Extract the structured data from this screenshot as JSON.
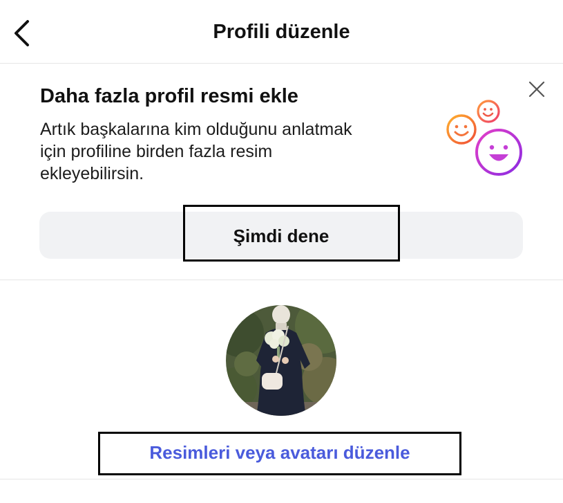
{
  "header": {
    "title": "Profili düzenle",
    "back_icon": "chevron-left-icon"
  },
  "promo": {
    "title": "Daha fazla profil resmi ekle",
    "description_lines": [
      "Artık başkalarına kim olduğunu anlatmak",
      "için profiline birden fazla resim",
      "ekleyebilirsin."
    ],
    "close_icon": "close-icon",
    "illustration_icon": "smiley-faces-icon",
    "button_label": "Şimdi dene"
  },
  "profile": {
    "avatar_icon": "profile-photo",
    "edit_link_label": "Resimleri veya avatarı düzenle"
  },
  "colors": {
    "link": "#4a5bdc",
    "button_bg": "#f1f2f4",
    "divider": "#e6e6e6",
    "text": "#111111"
  }
}
